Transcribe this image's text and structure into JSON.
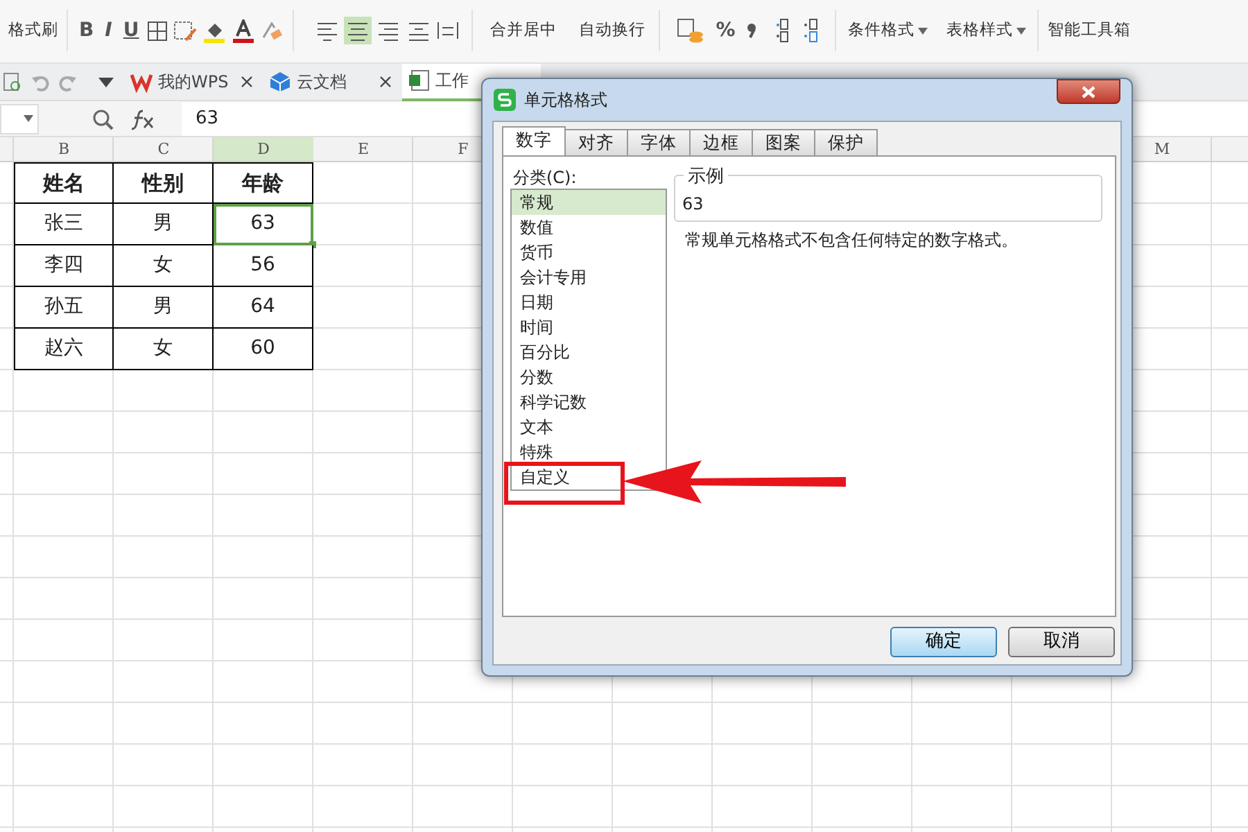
{
  "ribbon": {
    "format_painter": "格式刷",
    "font_styles": [
      "B",
      "I",
      "U"
    ],
    "merge": "合并居中",
    "wrap": "自动换行",
    "percent": "%",
    "conditional": "条件格式",
    "table_style": "表格样式",
    "toolbox": "智能工具箱"
  },
  "doc_tabs": [
    {
      "label": "我的WPS",
      "kind": "wps",
      "selected": false
    },
    {
      "label": "云文档",
      "kind": "cloud",
      "selected": false
    },
    {
      "label": "工作",
      "kind": "sheet",
      "selected": true
    }
  ],
  "formula_bar": {
    "value": "63"
  },
  "sheet": {
    "columns": [
      "B",
      "C",
      "D",
      "E",
      "F"
    ],
    "columns_right": [
      "M"
    ],
    "header": [
      "姓名",
      "性别",
      "年龄"
    ],
    "rows": [
      {
        "cells": [
          "张三",
          "男",
          "63"
        ],
        "selected": [
          false,
          false,
          true
        ]
      },
      {
        "cells": [
          "李四",
          "女",
          "56"
        ],
        "selected": [
          false,
          false,
          false
        ]
      },
      {
        "cells": [
          "孙五",
          "男",
          "64"
        ],
        "selected": [
          false,
          false,
          false
        ]
      },
      {
        "cells": [
          "赵六",
          "女",
          "60"
        ],
        "selected": [
          false,
          false,
          false
        ]
      }
    ]
  },
  "dialog": {
    "title": "单元格格式",
    "tabs": [
      {
        "label": "数字",
        "selected": true
      },
      {
        "label": "对齐",
        "selected": false
      },
      {
        "label": "字体",
        "selected": false
      },
      {
        "label": "边框",
        "selected": false
      },
      {
        "label": "图案",
        "selected": false
      },
      {
        "label": "保护",
        "selected": false
      }
    ],
    "category_label": "分类(C):",
    "categories": [
      {
        "label": "常规",
        "selected": true
      },
      {
        "label": "数值",
        "selected": false
      },
      {
        "label": "货币",
        "selected": false
      },
      {
        "label": "会计专用",
        "selected": false
      },
      {
        "label": "日期",
        "selected": false
      },
      {
        "label": "时间",
        "selected": false
      },
      {
        "label": "百分比",
        "selected": false
      },
      {
        "label": "分数",
        "selected": false
      },
      {
        "label": "科学记数",
        "selected": false
      },
      {
        "label": "文本",
        "selected": false
      },
      {
        "label": "特殊",
        "selected": false
      },
      {
        "label": "自定义",
        "selected": false
      }
    ],
    "sample_label": "示例",
    "sample_value": "63",
    "description": "常规单元格格式不包含任何特定的数字格式。",
    "buttons": [
      {
        "label": "确定",
        "default": true
      },
      {
        "label": "取消",
        "default": false
      }
    ]
  }
}
